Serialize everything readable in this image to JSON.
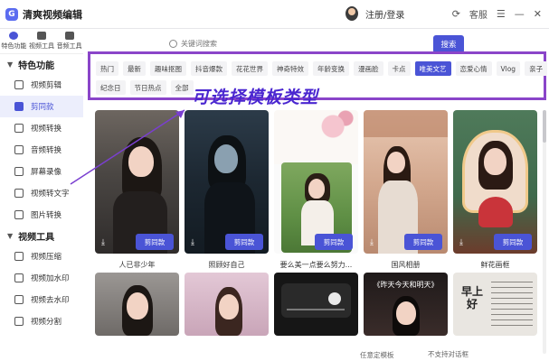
{
  "app": {
    "title": "清爽视频编辑",
    "login": "注册/登录",
    "support": "客服"
  },
  "rail": {
    "tabs": [
      {
        "label": "特色功能"
      },
      {
        "label": "视频工具"
      },
      {
        "label": "音频工具"
      }
    ],
    "groups": [
      {
        "title": "特色功能",
        "items": [
          "视频剪辑",
          "剪同款",
          "视频转换",
          "音频转换",
          "屏幕录像",
          "视频转文字",
          "图片转换"
        ]
      },
      {
        "title": "视频工具",
        "items": [
          "视频压缩",
          "视频加水印",
          "视频去水印",
          "视频分割"
        ]
      }
    ]
  },
  "search": {
    "placeholder": "关键词搜索",
    "button": "搜索"
  },
  "tags": {
    "row1": [
      "热门",
      "最新",
      "趣味抠图",
      "抖音爆款",
      "花花世界",
      "神奇特效",
      "年龄变换",
      "漫画脸",
      "卡点",
      "唯美文艺",
      "恋爱心情",
      "Vlog",
      "亲子"
    ],
    "row2": [
      "纪念日",
      "节日热点",
      "全部"
    ],
    "active": "唯美文艺"
  },
  "annotation": "可选择模板类型",
  "card_action": "剪同款",
  "cards": [
    {
      "title": "人已非少年"
    },
    {
      "title": "照顾好自己"
    },
    {
      "title": "要么美一点要么努力..."
    },
    {
      "title": "国风相册"
    },
    {
      "title": "鲜花画框"
    }
  ],
  "row2": [
    {
      "text": ""
    },
    {
      "text": ""
    },
    {
      "text": ""
    },
    {
      "text": "《昨天今天和明天》"
    },
    {
      "text": "早上好"
    }
  ],
  "footer": {
    "left": "任意定模板",
    "right": "不支持对话框"
  },
  "colors": {
    "accent": "#4a54d6",
    "highlight": "#8a45c9",
    "annotation": "#4a26d0"
  }
}
